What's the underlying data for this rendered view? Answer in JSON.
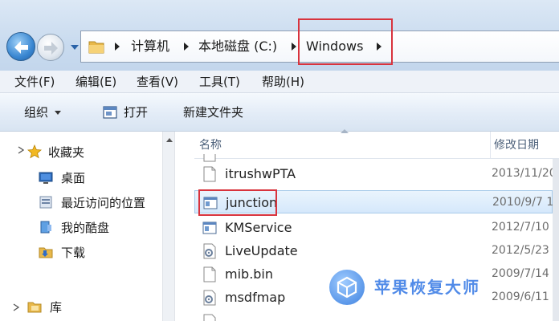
{
  "address_bar": {
    "crumbs": [
      "计算机",
      "本地磁盘 (C:)",
      "Windows"
    ]
  },
  "menu": {
    "items": [
      "文件(F)",
      "编辑(E)",
      "查看(V)",
      "工具(T)",
      "帮助(H)"
    ]
  },
  "toolbar": {
    "organize": "组织",
    "open": "打开",
    "new_folder": "新建文件夹"
  },
  "nav_pane": {
    "favorites": "收藏夹",
    "desktop": "桌面",
    "recent": "最近访问的位置",
    "cool_disk": "我的酷盘",
    "downloads": "下载",
    "libraries": "库"
  },
  "columns": {
    "name": "名称",
    "date": "修改日期"
  },
  "files": [
    {
      "name": "itrushwPTA",
      "date": "2013/11/20",
      "icon": "generic-file-icon"
    },
    {
      "name": "junction",
      "date": "2010/9/7 1",
      "icon": "app-icon",
      "selected": true
    },
    {
      "name": "KMService",
      "date": "2012/7/10",
      "icon": "app-icon"
    },
    {
      "name": "LiveUpdate",
      "date": "2012/5/23",
      "icon": "gear-file-icon"
    },
    {
      "name": "mib.bin",
      "date": "2009/7/14",
      "icon": "generic-file-icon"
    },
    {
      "name": "msdfmap",
      "date": "2009/6/11",
      "icon": "gear-file-icon"
    }
  ],
  "watermark": {
    "text": "苹果恢复大师"
  },
  "colors": {
    "highlight_red": "#d8333d",
    "selection_blue": "#d5e8fb",
    "header_text": "#4c607a"
  }
}
